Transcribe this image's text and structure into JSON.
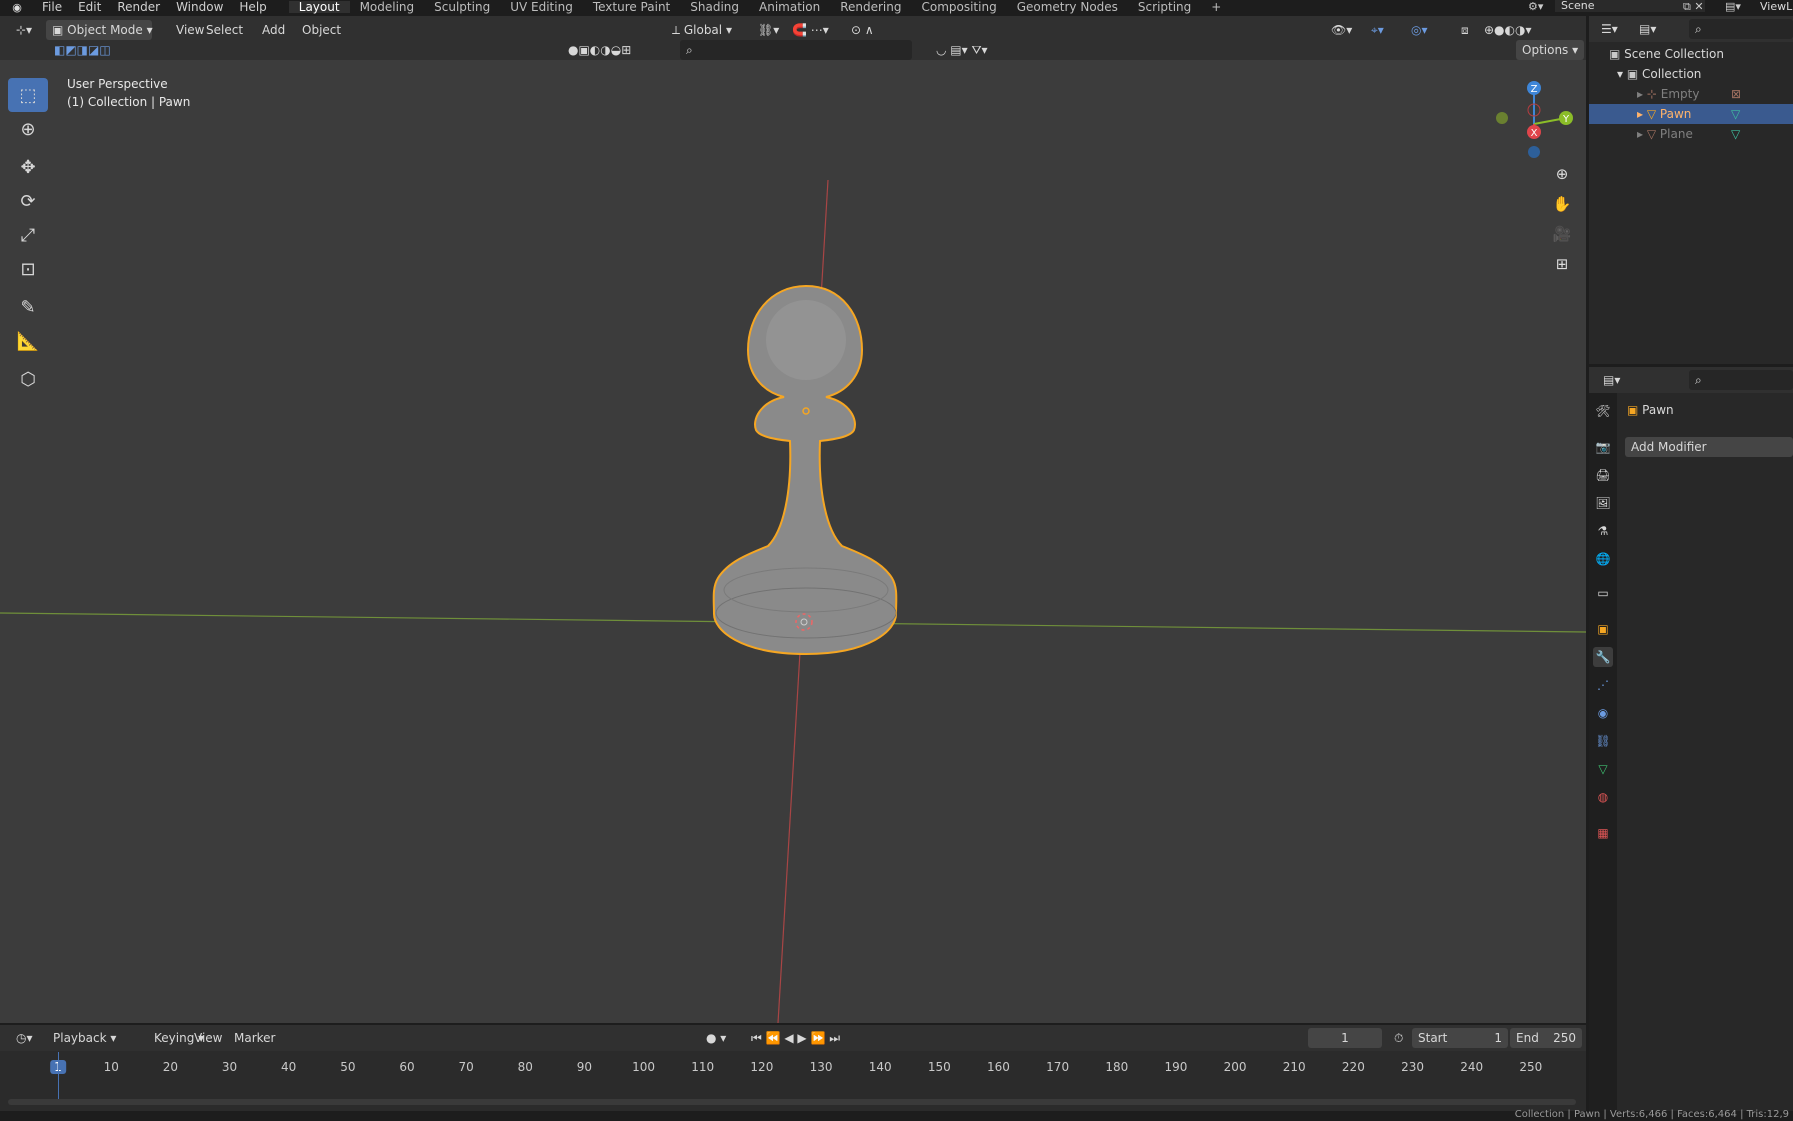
{
  "topbar": {
    "menus": [
      "File",
      "Edit",
      "Render",
      "Window",
      "Help"
    ],
    "workspaces": [
      "Layout",
      "Modeling",
      "Sculpting",
      "UV Editing",
      "Texture Paint",
      "Shading",
      "Animation",
      "Rendering",
      "Compositing",
      "Geometry Nodes",
      "Scripting",
      "+"
    ],
    "scene": "Scene",
    "view_layer": "ViewL"
  },
  "header3d": {
    "mode": "Object Mode",
    "menus": [
      "View",
      "Select",
      "Add",
      "Object"
    ],
    "orientation": "Global",
    "options": "Options"
  },
  "viewport": {
    "view_name": "User Perspective",
    "collection_info": "(1) Collection | Pawn",
    "gizmo": {
      "x": "X",
      "y": "Y",
      "z": "Z"
    }
  },
  "timeline": {
    "menus": [
      "Playback",
      "Keying",
      "View",
      "Marker"
    ],
    "current_frame": "1",
    "start_label": "Start",
    "start_value": "1",
    "end_label": "End",
    "end_value": "250",
    "ticks": [
      "1",
      "10",
      "20",
      "30",
      "40",
      "50",
      "60",
      "70",
      "80",
      "90",
      "100",
      "110",
      "120",
      "130",
      "140",
      "150",
      "160",
      "170",
      "180",
      "190",
      "200",
      "210",
      "220",
      "230",
      "240",
      "250"
    ]
  },
  "outliner": {
    "root": "Scene Collection",
    "collection": "Collection",
    "items": [
      "Empty",
      "Pawn",
      "Plane"
    ]
  },
  "properties": {
    "object_name": "Pawn",
    "add_modifier": "Add Modifier"
  },
  "status": {
    "text": "Collection | Pawn | Verts:6,466 | Faces:6,464 | Tris:12,9"
  },
  "colors": {
    "accent": "#4772b3",
    "selection_outline": "#f5a623",
    "x_axis": "#e0454b",
    "y_axis": "#8bbd28",
    "z_axis": "#3e86d8"
  }
}
